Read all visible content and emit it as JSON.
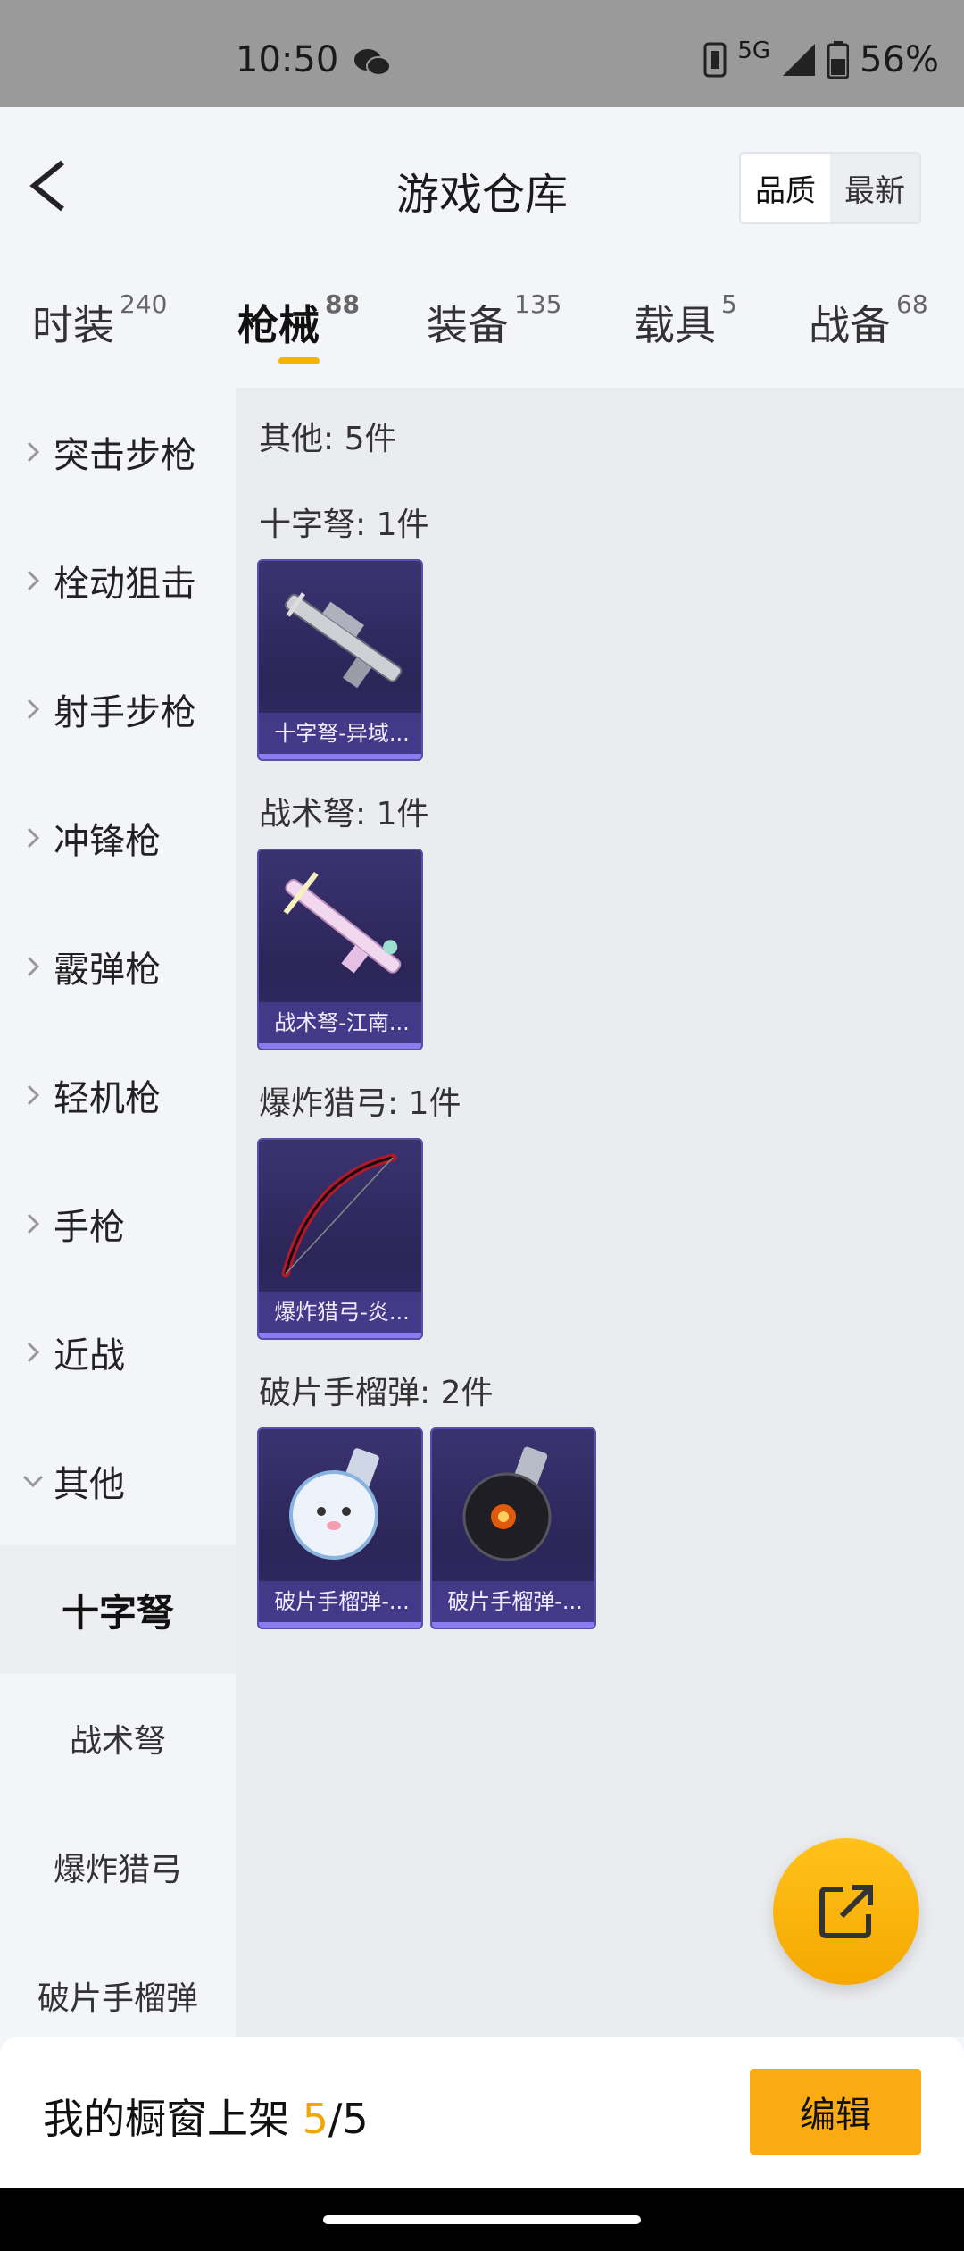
{
  "status": {
    "time": "10:50",
    "network": "5G",
    "battery": "56%"
  },
  "header": {
    "title": "游戏仓库",
    "sort": [
      "品质",
      "最新"
    ]
  },
  "tabs": [
    {
      "label": "时装",
      "count": "240"
    },
    {
      "label": "枪械",
      "count": "88"
    },
    {
      "label": "装备",
      "count": "135"
    },
    {
      "label": "载具",
      "count": "5"
    },
    {
      "label": "战备",
      "count": "68"
    }
  ],
  "sidebar": {
    "categories": [
      "突击步枪",
      "栓动狙击",
      "射手步枪",
      "冲锋枪",
      "霰弹枪",
      "轻机枪",
      "手枪",
      "近战",
      "其他"
    ],
    "subcategories": [
      "十字弩",
      "战术弩",
      "爆炸猎弓",
      "破片手榴弹"
    ],
    "selected_sub": "十字弩"
  },
  "content": {
    "summary": "其他: 5件",
    "groups": [
      {
        "head": "十字弩: 1件",
        "items": [
          "十字弩-异域..."
        ]
      },
      {
        "head": "战术弩: 1件",
        "items": [
          "战术弩-江南..."
        ]
      },
      {
        "head": "爆炸猎弓: 1件",
        "items": [
          "爆炸猎弓-炎..."
        ]
      },
      {
        "head": "破片手榴弹: 2件",
        "items": [
          "破片手榴弹-...",
          "破片手榴弹-..."
        ]
      }
    ]
  },
  "footer": {
    "label": "我的橱窗上架",
    "current": "5",
    "sep": "/",
    "total": "5",
    "edit": "编辑"
  },
  "colors": {
    "accent": "#f4b400",
    "card": "#2b2558",
    "button": "#fbab12"
  },
  "icons": [
    "wechat-icon",
    "sim-icon",
    "signal-icon",
    "battery-icon",
    "back-arrow-icon",
    "chevron-right-icon",
    "chevron-down-icon",
    "share-external-icon"
  ]
}
